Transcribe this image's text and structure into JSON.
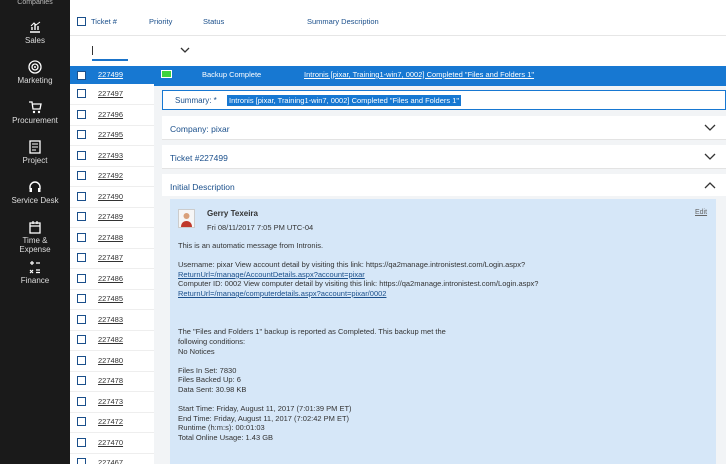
{
  "nav": {
    "top_label": "Companies",
    "items": [
      {
        "label": "Sales",
        "icon": "sales-icon"
      },
      {
        "label": "Marketing",
        "icon": "target-icon"
      },
      {
        "label": "Procurement",
        "icon": "cart-icon"
      },
      {
        "label": "Project",
        "icon": "project-icon"
      },
      {
        "label": "Service Desk",
        "icon": "headset-icon"
      },
      {
        "label": "Time &",
        "label2": "Expense",
        "icon": "calendar-icon"
      },
      {
        "label": "Finance",
        "icon": "finance-icon"
      }
    ]
  },
  "grid": {
    "columns": [
      "Ticket #",
      "Priority",
      "Status",
      "Summary Description"
    ],
    "tickets": [
      "227499",
      "227497",
      "227496",
      "227495",
      "227493",
      "227492",
      "227490",
      "227489",
      "227488",
      "227487",
      "227486",
      "227485",
      "227483",
      "227482",
      "227480",
      "227478",
      "227473",
      "227472",
      "227470",
      "227467"
    ],
    "selected": {
      "ticket": "227499",
      "priority_color": "#3ed43e",
      "status": "Backup Complete",
      "summary": "Intronis [pixar, Training1-win7, 0002] Completed \"Files and Folders 1\""
    }
  },
  "detail": {
    "summary_label": "Summary:  *",
    "summary_value": "Intronis [pixar, Training1-win7, 0002] Completed \"Files and Folders 1\"",
    "sections": [
      "Company: pixar",
      "Ticket #227499",
      "Initial Description"
    ],
    "note": {
      "author": "Gerry Texeira",
      "date": "Fri 08/11/2017 7:05 PM UTC-04",
      "edit": "Edit",
      "lines": [
        "This is an automatic message from Intronis.",
        "",
        "Username: pixar View account detail by visiting this link: https://qa2manage.intronistest.com/Login.aspx?",
        "ReturnUrl=/manage/AccountDetails.aspx?account=pixar",
        "Computer ID: 0002 View computer detail by visiting this link: https://qa2manage.intronistest.com/Login.aspx?",
        "ReturnUrl=/manage/computerdetails.aspx?account=pixar/0002",
        "",
        "",
        "",
        "The \"Files and Folders 1\" backup is reported as Completed. This backup met the",
        "following conditions:",
        "No Notices",
        "",
        "Files In Set: 7830",
        "Files Backed Up: 6",
        "Data Sent: 30.98 KB",
        "",
        "Start Time: Friday, August 11, 2017 (7:01:39 PM ET)",
        "End Time: Friday, August 11, 2017 (7:02:42 PM ET)",
        "Runtime (h:m:s): 00:01:03",
        "Total Online Usage: 1.43 GB"
      ]
    }
  },
  "colors": {
    "accent": "#1778d2",
    "nav_bg": "#1a1a1a",
    "note_bg": "#d6e7f8"
  }
}
